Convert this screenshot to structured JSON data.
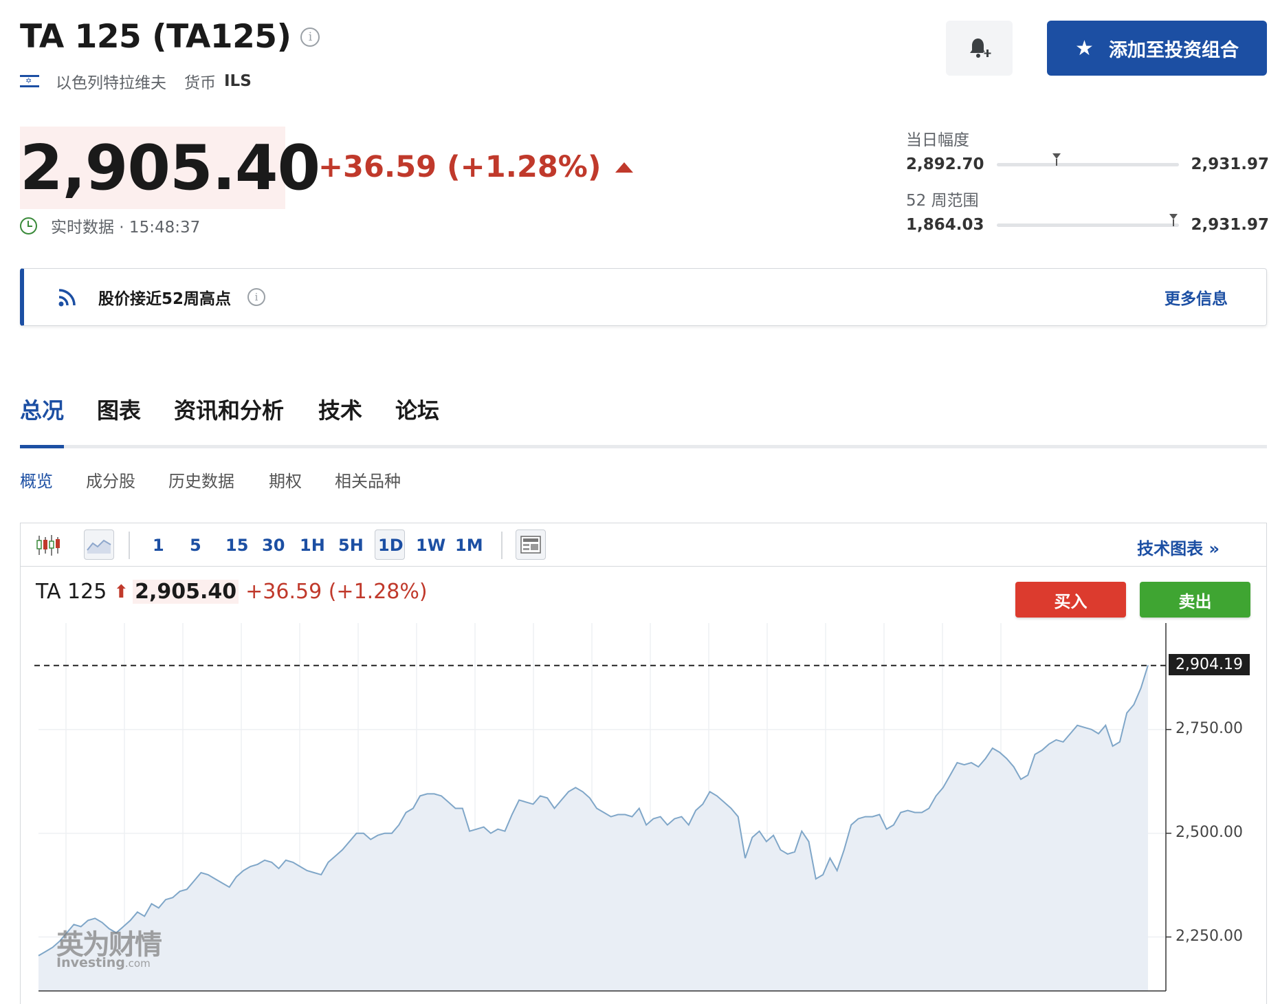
{
  "header": {
    "title": "TA 125 (TA125)",
    "exchange": "以色列特拉维夫",
    "currency_label": "货币",
    "currency": "ILS",
    "add_portfolio": "添加至投资组合"
  },
  "quote": {
    "price": "2,905.40",
    "change": "+36.59 (+1.28%)",
    "realtime": "实时数据 · 15:48:37"
  },
  "ranges": {
    "day": {
      "label": "当日幅度",
      "low": "2,892.70",
      "high": "2,931.97",
      "position": 0.33
    },
    "week52": {
      "label": "52 周范围",
      "low": "1,864.03",
      "high": "2,931.97",
      "position": 0.97
    }
  },
  "alert": {
    "message": "股价接近52周高点",
    "more": "更多信息"
  },
  "tabs": [
    "总况",
    "图表",
    "资讯和分析",
    "技术",
    "论坛"
  ],
  "subtabs": [
    "概览",
    "成分股",
    "历史数据",
    "期权",
    "相关品种"
  ],
  "toolbar": {
    "intervals": [
      "1",
      "5",
      "15",
      "30",
      "1H",
      "5H",
      "1D",
      "1W",
      "1M"
    ],
    "selected": "1D",
    "tech_chart": "技术图表 »"
  },
  "chart_header": {
    "name": "TA 125",
    "price": "2,905.40",
    "change": "+36.59 (+1.28%)",
    "buy": "买入",
    "sell": "卖出"
  },
  "watermark": {
    "cn": "英为财情",
    "en": "Investing",
    "suffix": ".com"
  },
  "chart_data": {
    "type": "area",
    "title": "",
    "xlabel": "",
    "ylabel": "",
    "ylim": [
      2120,
      2990
    ],
    "yticks": [
      "2,750.00",
      "2,500.00",
      "2,250.00"
    ],
    "ytick_values": [
      2750,
      2500,
      2250
    ],
    "last_value": 2904.19,
    "last_label": "2,904.19",
    "color": "#7fa6c8",
    "fill": "#e9eef5",
    "grid": true,
    "series": [
      {
        "values": [
          2205,
          2215,
          2225,
          2240,
          2260,
          2280,
          2275,
          2290,
          2295,
          2285,
          2270,
          2260,
          2275,
          2290,
          2310,
          2300,
          2330,
          2320,
          2340,
          2345,
          2360,
          2365,
          2385,
          2405,
          2400,
          2390,
          2380,
          2370,
          2395,
          2410,
          2420,
          2425,
          2435,
          2430,
          2415,
          2435,
          2430,
          2420,
          2410,
          2405,
          2400,
          2430,
          2445,
          2460,
          2480,
          2500,
          2500,
          2485,
          2495,
          2500,
          2500,
          2520,
          2550,
          2560,
          2590,
          2595,
          2595,
          2590,
          2575,
          2560,
          2560,
          2505,
          2510,
          2515,
          2500,
          2510,
          2505,
          2545,
          2580,
          2575,
          2570,
          2590,
          2585,
          2560,
          2580,
          2600,
          2610,
          2600,
          2585,
          2560,
          2550,
          2540,
          2545,
          2545,
          2540,
          2560,
          2520,
          2535,
          2540,
          2520,
          2535,
          2540,
          2520,
          2555,
          2570,
          2600,
          2590,
          2575,
          2560,
          2540,
          2440,
          2490,
          2505,
          2480,
          2495,
          2460,
          2450,
          2455,
          2505,
          2480,
          2390,
          2400,
          2440,
          2410,
          2460,
          2520,
          2535,
          2540,
          2540,
          2545,
          2510,
          2520,
          2550,
          2555,
          2550,
          2550,
          2560,
          2590,
          2610,
          2640,
          2670,
          2665,
          2670,
          2660,
          2680,
          2705,
          2695,
          2680,
          2660,
          2630,
          2640,
          2690,
          2700,
          2715,
          2725,
          2720,
          2740,
          2760,
          2755,
          2750,
          2740,
          2760,
          2710,
          2720,
          2790,
          2810,
          2850,
          2905
        ]
      }
    ]
  }
}
